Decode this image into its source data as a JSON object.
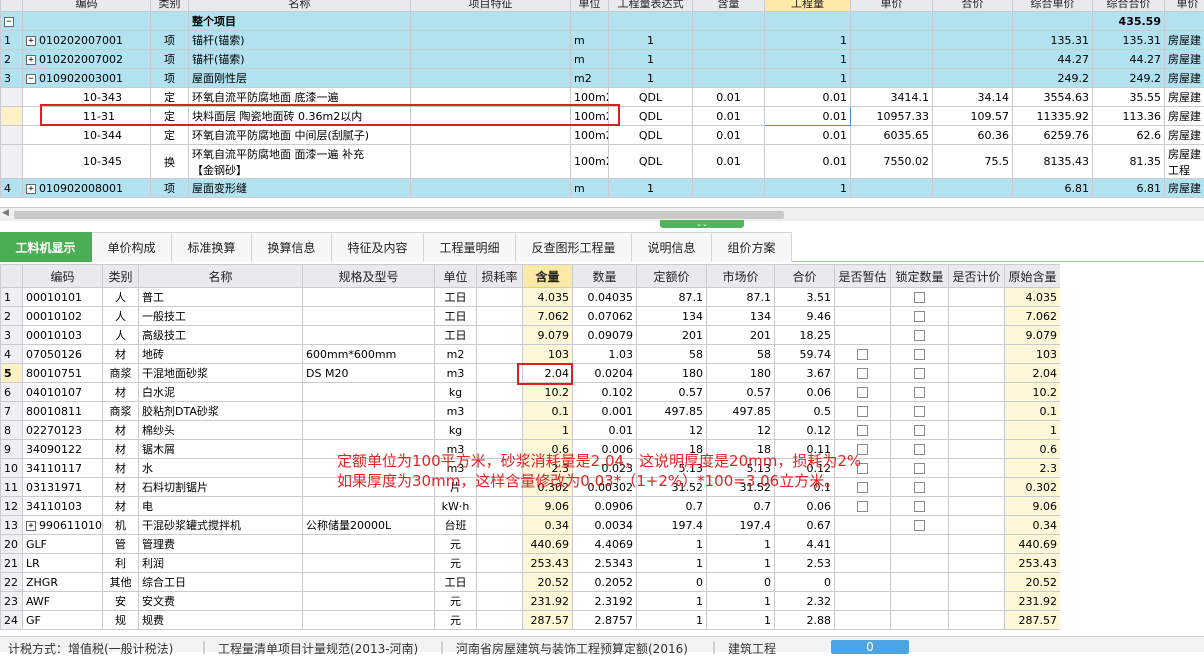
{
  "top": {
    "headers": [
      "编码",
      "类别",
      "名称",
      "项目特征",
      "单位",
      "工程量表达式",
      "含量",
      "工程量",
      "单价",
      "合价",
      "综合单价",
      "综合合价",
      "单价"
    ],
    "total_row": {
      "label": "整个项目",
      "value": "435.59"
    },
    "rows": [
      {
        "idx": "1",
        "code": "010202007001",
        "type": "项",
        "name": "锚杆(锚索)",
        "unit": "m",
        "expr": "1",
        "qty": "1",
        "uprice": "135.31",
        "total": "135.31",
        "cat": "房屋建",
        "name2": ""
      },
      {
        "idx": "2",
        "code": "010202007002",
        "type": "项",
        "name": "锚杆(锚索)",
        "unit": "m",
        "expr": "1",
        "qty": "1",
        "uprice": "44.27",
        "total": "44.27",
        "cat": "房屋建",
        "name2": ""
      },
      {
        "idx": "3",
        "code": "010902003001",
        "type": "项",
        "name": "屋面刚性层",
        "unit": "m2",
        "expr": "1",
        "qty": "1",
        "uprice": "249.2",
        "total": "249.2",
        "cat": "房屋建",
        "name2": ""
      }
    ],
    "sub_rows": [
      {
        "code": "10-343",
        "type": "定",
        "name": "环氧自流平防腐地面 底漆一遍",
        "unit": "100m2",
        "expr": "QDL",
        "content": "0.01",
        "qty": "0.01",
        "price": "3414.1",
        "sum": "34.14",
        "uprice": "3554.63",
        "total": "35.55",
        "cat": "房屋建"
      },
      {
        "code": "11-31",
        "type": "定",
        "name": "块料面层 陶瓷地面砖 0.36m2以内",
        "unit": "100m2",
        "expr": "QDL",
        "content": "0.01",
        "qty": "0.01",
        "price": "10957.33",
        "sum": "109.57",
        "uprice": "11335.92",
        "total": "113.36",
        "cat": "房屋建"
      },
      {
        "code": "10-344",
        "type": "定",
        "name": "环氧自流平防腐地面 中间层(刮腻子)",
        "unit": "100m2",
        "expr": "QDL",
        "content": "0.01",
        "qty": "0.01",
        "price": "6035.65",
        "sum": "60.36",
        "uprice": "6259.76",
        "total": "62.6",
        "cat": "房屋建"
      },
      {
        "code": "10-345",
        "type": "换",
        "name": "环氧自流平防腐地面 面漆一遍  补充",
        "name2": "【金钢砂】",
        "unit": "100m2",
        "expr": "QDL",
        "content": "0.01",
        "qty": "0.01",
        "price": "7550.02",
        "sum": "75.5",
        "uprice": "8135.43",
        "total": "81.35",
        "cat": "房屋建",
        "cat2": "工程"
      }
    ],
    "last_row": {
      "idx": "4",
      "code": "010902008001",
      "type": "项",
      "name": "屋面变形缝",
      "unit": "m",
      "expr": "1",
      "qty": "1",
      "uprice": "6.81",
      "total": "6.81",
      "cat": "房屋建"
    }
  },
  "tabs": [
    "工料机显示",
    "单价构成",
    "标准换算",
    "换算信息",
    "特征及内容",
    "工程量明细",
    "反查图形工程量",
    "说明信息",
    "组价方案"
  ],
  "bottom": {
    "headers": [
      "",
      "编码",
      "类别",
      "名称",
      "规格及型号",
      "单位",
      "损耗率",
      "含量",
      "数量",
      "定额价",
      "市场价",
      "合价",
      "是否暂估",
      "锁定数量",
      "是否计价",
      "原始含量"
    ],
    "rows": [
      {
        "idx": "1",
        "code": "00010101",
        "type": "人",
        "name": "普工",
        "spec": "",
        "unit": "工日",
        "content": "4.035",
        "qty": "0.04035",
        "dprice": "87.1",
        "mprice": "87.1",
        "sum": "3.51",
        "est": false,
        "lock": true,
        "orig": "4.035"
      },
      {
        "idx": "2",
        "code": "00010102",
        "type": "人",
        "name": "一般技工",
        "spec": "",
        "unit": "工日",
        "content": "7.062",
        "qty": "0.07062",
        "dprice": "134",
        "mprice": "134",
        "sum": "9.46",
        "est": false,
        "lock": true,
        "orig": "7.062"
      },
      {
        "idx": "3",
        "code": "00010103",
        "type": "人",
        "name": "高级技工",
        "spec": "",
        "unit": "工日",
        "content": "9.079",
        "qty": "0.09079",
        "dprice": "201",
        "mprice": "201",
        "sum": "18.25",
        "est": false,
        "lock": true,
        "orig": "9.079"
      },
      {
        "idx": "4",
        "code": "07050126",
        "type": "材",
        "name": "地砖",
        "spec": "600mm*600mm",
        "unit": "m2",
        "content": "103",
        "qty": "1.03",
        "dprice": "58",
        "mprice": "58",
        "sum": "59.74",
        "est": true,
        "lock": true,
        "orig": "103"
      },
      {
        "idx": "5",
        "code": "80010751",
        "type": "商浆",
        "name": "干混地面砂浆",
        "spec": "DS M20",
        "unit": "m3",
        "content": "2.04",
        "qty": "0.0204",
        "dprice": "180",
        "mprice": "180",
        "sum": "3.67",
        "est": true,
        "lock": true,
        "orig": "2.04"
      },
      {
        "idx": "6",
        "code": "04010107",
        "type": "材",
        "name": "白水泥",
        "spec": "",
        "unit": "kg",
        "content": "10.2",
        "qty": "0.102",
        "dprice": "0.57",
        "mprice": "0.57",
        "sum": "0.06",
        "est": true,
        "lock": true,
        "orig": "10.2"
      },
      {
        "idx": "7",
        "code": "80010811",
        "type": "商浆",
        "name": "胶粘剂DTA砂浆",
        "spec": "",
        "unit": "m3",
        "content": "0.1",
        "qty": "0.001",
        "dprice": "497.85",
        "mprice": "497.85",
        "sum": "0.5",
        "est": true,
        "lock": true,
        "orig": "0.1"
      },
      {
        "idx": "8",
        "code": "02270123",
        "type": "材",
        "name": "棉纱头",
        "spec": "",
        "unit": "kg",
        "content": "1",
        "qty": "0.01",
        "dprice": "12",
        "mprice": "12",
        "sum": "0.12",
        "est": true,
        "lock": true,
        "orig": "1"
      },
      {
        "idx": "9",
        "code": "34090122",
        "type": "材",
        "name": "锯木屑",
        "spec": "",
        "unit": "m3",
        "content": "0.6",
        "qty": "0.006",
        "dprice": "18",
        "mprice": "18",
        "sum": "0.11",
        "est": true,
        "lock": true,
        "orig": "0.6"
      },
      {
        "idx": "10",
        "code": "34110117",
        "type": "材",
        "name": "水",
        "spec": "",
        "unit": "m3",
        "content": "2.3",
        "qty": "0.023",
        "dprice": "5.13",
        "mprice": "5.13",
        "sum": "0.12",
        "est": true,
        "lock": true,
        "orig": "2.3"
      },
      {
        "idx": "11",
        "code": "03131971",
        "type": "材",
        "name": "石料切割锯片",
        "spec": "",
        "unit": "片",
        "content": "0.302",
        "qty": "0.00302",
        "dprice": "31.52",
        "mprice": "31.52",
        "sum": "0.1",
        "est": true,
        "lock": true,
        "orig": "0.302"
      },
      {
        "idx": "12",
        "code": "34110103",
        "type": "材",
        "name": "电",
        "spec": "",
        "unit": "kW·h",
        "content": "9.06",
        "qty": "0.0906",
        "dprice": "0.7",
        "mprice": "0.7",
        "sum": "0.06",
        "est": true,
        "lock": true,
        "orig": "9.06"
      },
      {
        "idx": "13",
        "code": "990611010",
        "type": "机",
        "name": "干混砂浆罐式搅拌机",
        "spec": "公称储量20000L",
        "unit": "台班",
        "content": "0.34",
        "qty": "0.0034",
        "dprice": "197.4",
        "mprice": "197.4",
        "sum": "0.67",
        "est": false,
        "lock": true,
        "orig": "0.34"
      },
      {
        "idx": "20",
        "code": "GLF",
        "type": "管",
        "name": "管理费",
        "spec": "",
        "unit": "元",
        "content": "440.69",
        "qty": "4.4069",
        "dprice": "1",
        "mprice": "1",
        "sum": "4.41",
        "est": false,
        "lock": false,
        "orig": "440.69"
      },
      {
        "idx": "21",
        "code": "LR",
        "type": "利",
        "name": "利润",
        "spec": "",
        "unit": "元",
        "content": "253.43",
        "qty": "2.5343",
        "dprice": "1",
        "mprice": "1",
        "sum": "2.53",
        "est": false,
        "lock": false,
        "orig": "253.43"
      },
      {
        "idx": "22",
        "code": "ZHGR",
        "type": "其他",
        "name": "综合工日",
        "spec": "",
        "unit": "工日",
        "content": "20.52",
        "qty": "0.2052",
        "dprice": "0",
        "mprice": "0",
        "sum": "0",
        "est": false,
        "lock": false,
        "orig": "20.52"
      },
      {
        "idx": "23",
        "code": "AWF",
        "type": "安",
        "name": "安文费",
        "spec": "",
        "unit": "元",
        "content": "231.92",
        "qty": "2.3192",
        "dprice": "1",
        "mprice": "1",
        "sum": "2.32",
        "est": false,
        "lock": false,
        "orig": "231.92"
      },
      {
        "idx": "24",
        "code": "GF",
        "type": "规",
        "name": "规费",
        "spec": "",
        "unit": "元",
        "content": "287.57",
        "qty": "2.8757",
        "dprice": "1",
        "mprice": "1",
        "sum": "2.88",
        "est": false,
        "lock": false,
        "orig": "287.57"
      }
    ]
  },
  "annotation": {
    "line1": "定额单位为100平方米，砂浆消耗量是2.04，这说明厚度是20mm，损耗为2%",
    "line2": "如果厚度为30mm，这样含量修改为0.03*（1+2%）*100=3.06立方米。"
  },
  "status": {
    "calc": "计税方式：增值税(一般计税法)",
    "spec": "工程量清单项目计量规范(2013-河南)",
    "quota": "河南省房屋建筑与装饰工程预算定额(2016)",
    "major": "建筑工程",
    "button": "0"
  },
  "colors": {
    "accent_green": "#4cae54",
    "row_blue": "#b2e2f0",
    "highlight_header": "#fde9a6",
    "annotation_red": "#e22424"
  }
}
